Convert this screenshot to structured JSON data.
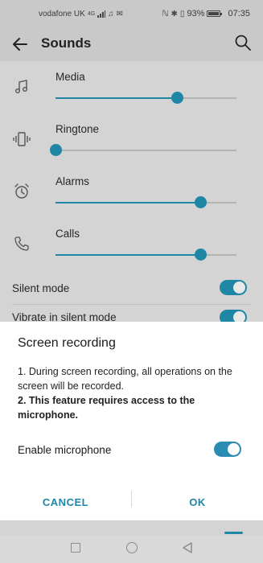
{
  "status_bar": {
    "carrier": "vodafone UK",
    "network": "4G",
    "battery_percent": "93%",
    "time": "07:35"
  },
  "app_bar": {
    "title": "Sounds"
  },
  "volume": {
    "media": {
      "label": "Media",
      "level": 0.67,
      "icon": "music-note-icon"
    },
    "ringtone": {
      "label": "Ringtone",
      "level": 0.0,
      "icon": "vibrate-icon"
    },
    "alarms": {
      "label": "Alarms",
      "level": 0.8,
      "icon": "alarm-clock-icon"
    },
    "calls": {
      "label": "Calls",
      "level": 0.8,
      "icon": "phone-icon"
    }
  },
  "toggles": {
    "silent_mode": {
      "label": "Silent mode",
      "on": true
    },
    "vibrate_in_silent": {
      "label": "Vibrate in silent mode",
      "on": true
    }
  },
  "dialog": {
    "title": "Screen recording",
    "line1": "1. During screen recording, all operations on the screen will be recorded.",
    "line2": "2. This feature requires access to the microphone.",
    "mic_label": "Enable microphone",
    "mic_on": true,
    "cancel_label": "CANCEL",
    "ok_label": "OK"
  },
  "colors": {
    "accent": "#1f86a6"
  }
}
